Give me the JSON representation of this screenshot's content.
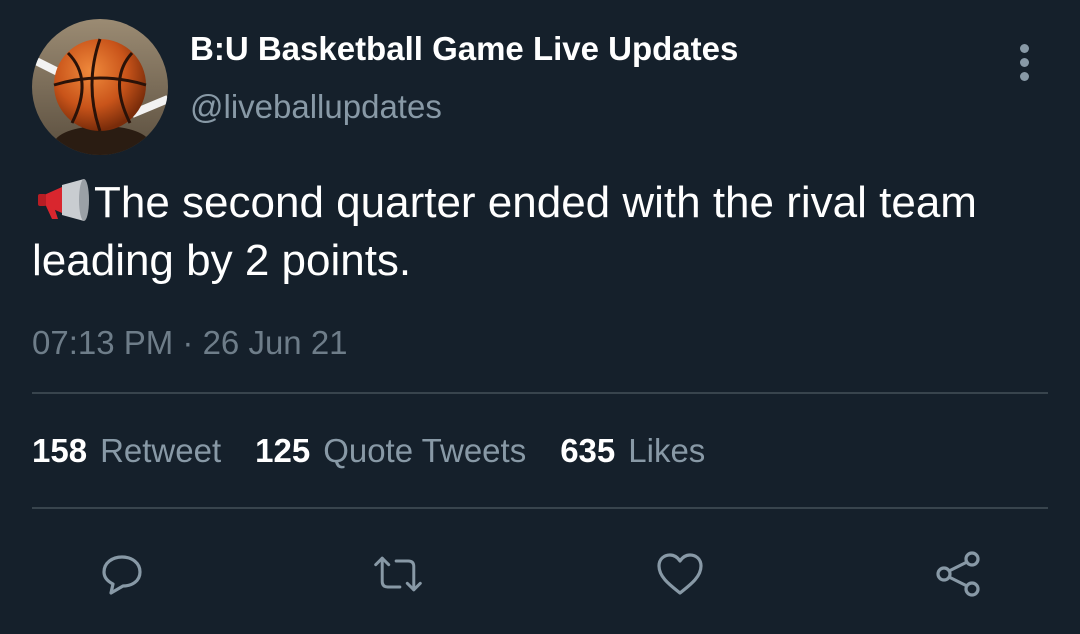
{
  "account": {
    "display_name": "B:U Basketball Game Live Updates",
    "handle": "@liveballupdates",
    "avatar_icon": "basketball-icon"
  },
  "tweet": {
    "emoji_icon": "megaphone-icon",
    "text": "The second quarter ended with the rival team leading by 2 points.",
    "timestamp": "07:13 PM · 26 Jun 21"
  },
  "stats": [
    {
      "count": "158",
      "label": "Retweet"
    },
    {
      "count": "125",
      "label": "Quote Tweets"
    },
    {
      "count": "635",
      "label": "Likes"
    }
  ],
  "actions": [
    "reply-icon",
    "retweet-icon",
    "like-icon",
    "share-icon"
  ],
  "colors": {
    "background": "#15202b",
    "secondary_text": "#8899a6",
    "divider": "#38444d",
    "primary_text": "#ffffff"
  }
}
